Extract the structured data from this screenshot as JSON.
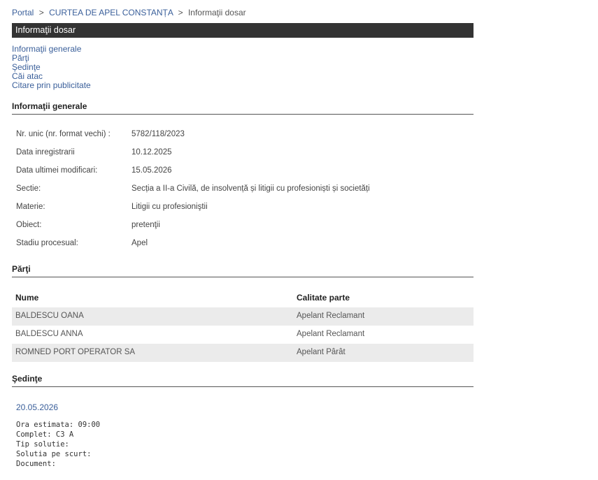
{
  "breadcrumb": {
    "portal": "Portal",
    "court": "CURTEA DE APEL CONSTANȚA",
    "current": "Informaţii dosar",
    "sep": ">"
  },
  "title": "Informaţii dosar",
  "nav": {
    "items": [
      "Informaţii generale",
      "Părţi",
      "Şedinţe",
      "Căi atac",
      "Citare prin publicitate"
    ]
  },
  "general": {
    "heading": "Informaţii generale",
    "rows": [
      {
        "label": "Nr. unic (nr. format vechi) :",
        "value": "5782/118/2023"
      },
      {
        "label": "Data inregistrarii",
        "value": "10.12.2025"
      },
      {
        "label": "Data ultimei modificari:",
        "value": "15.05.2026"
      },
      {
        "label": "Sectie:",
        "value": "Secția a II-a Civilă, de insolvență și litigii cu profesioniști și societăți"
      },
      {
        "label": "Materie:",
        "value": "Litigii cu profesioniştii"
      },
      {
        "label": "Obiect:",
        "value": "pretenţii"
      },
      {
        "label": "Stadiu procesual:",
        "value": "Apel"
      }
    ]
  },
  "parti": {
    "heading": "Părţi",
    "col_nume": "Nume",
    "col_calitate": "Calitate parte",
    "rows": [
      {
        "nume": "BALDESCU OANA",
        "calitate": "Apelant Reclamant"
      },
      {
        "nume": "BALDESCU ANNA",
        "calitate": "Apelant Reclamant"
      },
      {
        "nume": "ROMNED PORT OPERATOR SA",
        "calitate": "Apelant Pârât"
      }
    ]
  },
  "sedinte": {
    "heading": "Şedinţe",
    "date": "20.05.2026",
    "details": {
      "ora": "Ora estimata: 09:00",
      "complet": "Complet: C3 A",
      "tip": "Tip solutie:",
      "solutia": "Solutia pe scurt:",
      "document": "Document:"
    }
  }
}
